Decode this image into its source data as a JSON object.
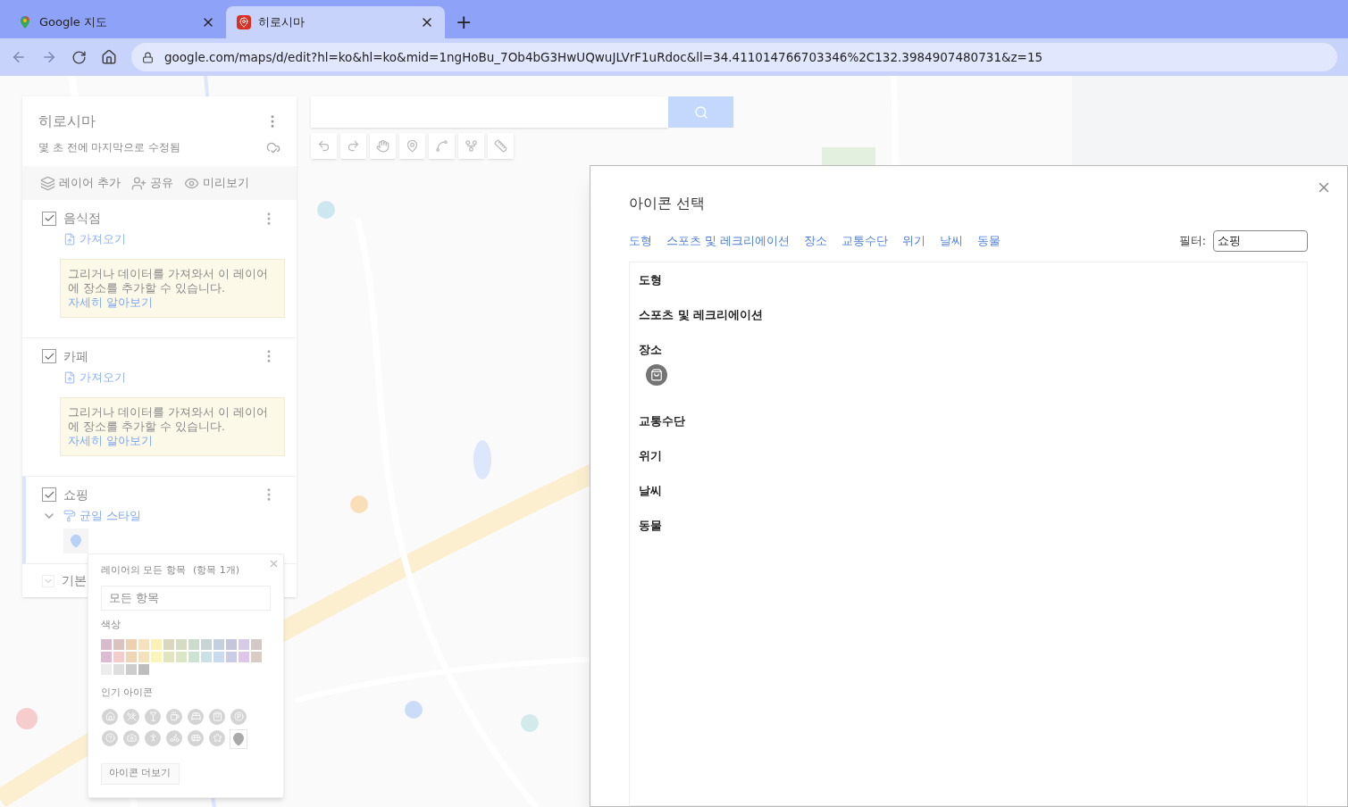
{
  "browser": {
    "tabs": [
      {
        "title": "Google 지도",
        "selected": false,
        "kind": "maps"
      },
      {
        "title": "히로시마",
        "selected": true,
        "kind": "pin"
      }
    ],
    "new_tab": "+",
    "url": "google.com/maps/d/edit?hl=ko&hl=ko&mid=1ngHoBu_7Ob4bG3HwUQwuJLVrF1uRdoc&ll=34.411014766703346%2C132.3984907480731&z=15"
  },
  "map": {
    "toolbar": [
      {
        "kind": "undo"
      },
      {
        "kind": "redo"
      },
      {
        "kind": "hand"
      },
      {
        "kind": "marker"
      },
      {
        "kind": "line"
      },
      {
        "kind": "route"
      },
      {
        "kind": "ruler"
      }
    ]
  },
  "panel": {
    "title": "히로시마",
    "subtitle": "몇 초 전에 마지막으로 수정됨",
    "actions": [
      {
        "label": "레이어 추가",
        "kind": "layers"
      },
      {
        "label": "공유",
        "kind": "share"
      },
      {
        "label": "미리보기",
        "kind": "preview"
      }
    ],
    "layers": [
      {
        "name": "음식점",
        "checked": true,
        "import_label": "가져오기",
        "hint": "그리거나 데이터를 가져와서 이 레이어에 장소를 추가할 수 있습니다.",
        "hint_link": "자세히 알아보기"
      },
      {
        "name": "카페",
        "checked": true,
        "import_label": "가져오기",
        "hint": "그리거나 데이터를 가져와서 이 레이어에 장소를 추가할 수 있습니다.",
        "hint_link": "자세히 알아보기"
      },
      {
        "name": "쇼핑",
        "checked": true,
        "style_label": "균일 스타일",
        "expanded": true
      }
    ],
    "base_layer": "기본"
  },
  "popover": {
    "heading": "레이어의 모든 항목",
    "count": "(항목 1개)",
    "field_value": "모든 항목",
    "color_label": "색상",
    "colors": [
      {
        "color": "#d8bccd"
      },
      {
        "color": "#dcc2bc"
      },
      {
        "color": "#eecfb2"
      },
      {
        "color": "#f5e1bb"
      },
      {
        "color": "#fbf0b6"
      },
      {
        "color": "#d9d7bd"
      },
      {
        "color": "#d5dcc3"
      },
      {
        "color": "#ccdccc"
      },
      {
        "color": "#c8d4d3"
      },
      {
        "color": "#c4cfe0"
      },
      {
        "color": "#c5c6dd"
      },
      {
        "color": "#d6cbe6"
      },
      {
        "color": "#d2c8c6"
      },
      {
        "color": "#e0bcd2"
      },
      {
        "color": "#f3cccb"
      },
      {
        "color": "#f1d4b5"
      },
      {
        "color": "#f4e2bb"
      },
      {
        "color": "#fcf5b8"
      },
      {
        "color": "#e3e5c0"
      },
      {
        "color": "#dbe6c7"
      },
      {
        "color": "#cde3d1"
      },
      {
        "color": "#cbe1e6"
      },
      {
        "color": "#c9dbef"
      },
      {
        "color": "#cacbe6"
      },
      {
        "color": "#dec6e8"
      },
      {
        "color": "#d9cdc8"
      },
      {
        "color": "#ececec"
      },
      {
        "color": "#dedede"
      },
      {
        "color": "#cdcdcd"
      },
      {
        "color": "#bdbdbd"
      }
    ],
    "icons_label": "인기 아이콘",
    "icons": [
      {
        "kind": "house",
        "selected": false
      },
      {
        "kind": "restaurant",
        "selected": false
      },
      {
        "kind": "bar",
        "selected": false
      },
      {
        "kind": "cafe",
        "selected": false
      },
      {
        "kind": "hotel",
        "selected": false
      },
      {
        "kind": "shopping",
        "selected": false
      },
      {
        "kind": "parking",
        "selected": false
      },
      {
        "kind": "help",
        "selected": false
      },
      {
        "kind": "camera",
        "selected": false
      },
      {
        "kind": "person",
        "selected": false
      },
      {
        "kind": "bike",
        "selected": false
      },
      {
        "kind": "transit",
        "selected": false
      },
      {
        "kind": "star",
        "selected": false
      },
      {
        "kind": "pin",
        "selected": true
      }
    ],
    "more_button": "아이콘 더보기"
  },
  "dialog": {
    "title": "아이콘 선택",
    "tabs": [
      "도형",
      "스포츠 및 레크리에이션",
      "장소",
      "교통수단",
      "위기",
      "날씨",
      "동물"
    ],
    "filter_label": "필터:",
    "filter_value": "쇼핑",
    "sections": [
      {
        "title": "도형"
      },
      {
        "title": "스포츠 및 레크리에이션"
      },
      {
        "title": "장소",
        "icons": [
          {
            "kind": "shopping"
          }
        ]
      },
      {
        "title": "교통수단"
      },
      {
        "title": "위기"
      },
      {
        "title": "날씨"
      },
      {
        "title": "동물"
      }
    ]
  }
}
